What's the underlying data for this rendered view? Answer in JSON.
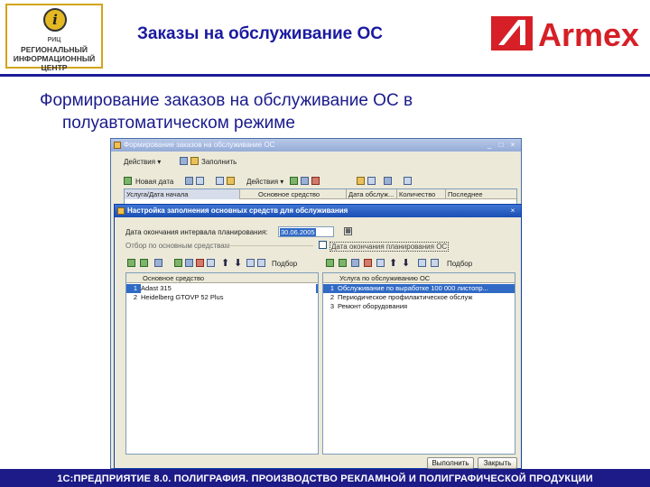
{
  "header": {
    "logo_lines": [
      "РЕГИОНАЛЬНЫЙ",
      "ИНФОРМАЦИОННЫЙ",
      "ЦЕНТР"
    ],
    "logo_mark": "РИЦ",
    "title": "Заказы на обслуживание ОС",
    "brand": "Armex",
    "brand_color": "#d61f26",
    "accent_color": "#1b1d9a"
  },
  "heading": {
    "line1": "Формирование заказов на обслуживание ОС в",
    "line2": "полуавтоматическом режиме"
  },
  "outer_window": {
    "title": "Формирование заказов на обслуживание ОС",
    "toolbar1": {
      "actions": "Действия ▾",
      "fill": "Заполнить"
    },
    "toolbar2": {
      "new_date": "Новая дата",
      "actions": "Действия ▾"
    },
    "columns": [
      "Услуга/Дата начала",
      "Основное средство",
      "Дата обслуж...",
      "Количество",
      "Последнее"
    ]
  },
  "dialog": {
    "title": "Настройка заполнения основных средств для обслуживания",
    "date_label": "Дата окончания интервала планирования:",
    "date_value": "30.06.2005",
    "left_section": "Отбор по основным средствам",
    "right_section": "Дата окончания планирования ОС",
    "select_left": "Подбор",
    "select_right": "Подбор",
    "left_grid": {
      "header": "Основное средство",
      "rows": [
        {
          "n": "1",
          "text": "Adast 315"
        },
        {
          "n": "2",
          "text": "Heidelberg GTOVP 52 Plus"
        }
      ]
    },
    "right_grid": {
      "header": "Услуга по обслуживанию ОС",
      "rows": [
        {
          "n": "1",
          "text": "Обслуживание по выработке 100 000 листопр..."
        },
        {
          "n": "2",
          "text": "Периодическое профилактическое обслуж"
        },
        {
          "n": "3",
          "text": "Ремонт оборудования"
        }
      ]
    },
    "run_button": "Выполнить",
    "close_button": "Закрыть"
  },
  "footer": {
    "text": "1С:ПРЕДПРИЯТИЕ 8.0. ПОЛИГРАФИЯ. ПРОИЗВОДСТВО РЕКЛАМНОЙ И ПОЛИГРАФИЧЕСКОЙ ПРОДУКЦИИ"
  }
}
